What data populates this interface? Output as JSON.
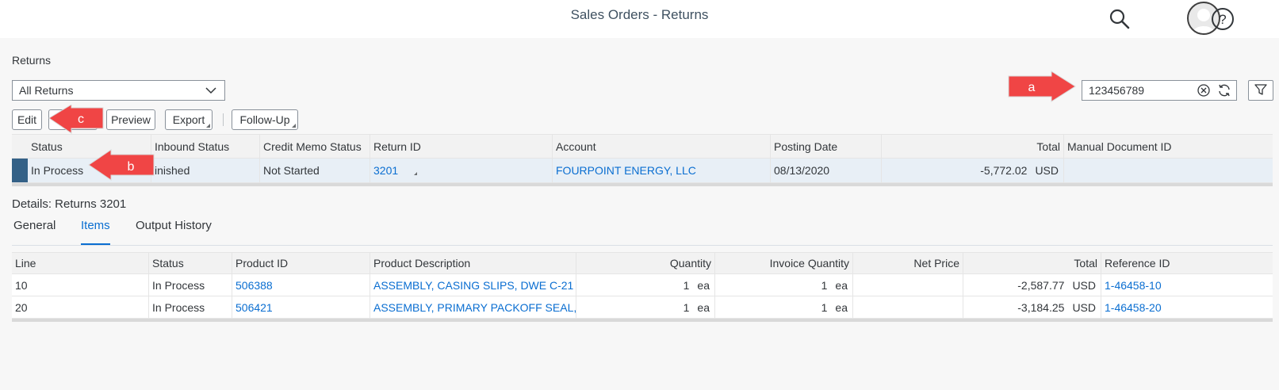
{
  "shell": {
    "title": "Sales Orders - Returns",
    "icons": [
      "search-icon",
      "user-avatar",
      "help-icon"
    ]
  },
  "returns": {
    "title": "Returns",
    "variant": "All Returns",
    "search_value": "123456789",
    "toolbar": {
      "edit": "Edit",
      "preview": "Preview",
      "export": "Export",
      "follow_up": "Follow-Up"
    },
    "columns": [
      "Status",
      "Inbound Status",
      "Credit Memo Status",
      "Return ID",
      "Account",
      "Posting Date",
      "Total",
      "Manual Document ID"
    ],
    "rows": [
      {
        "status": "In Process",
        "inbound_status": "inished",
        "credit_memo_status": "Not Started",
        "return_id": "3201",
        "account": "FOURPOINT ENERGY, LLC",
        "posting_date": "08/13/2020",
        "total": "-5,772.02",
        "currency": "USD",
        "manual_document_id": ""
      }
    ]
  },
  "details": {
    "title": "Details: Returns 3201",
    "tabs": [
      "General",
      "Items",
      "Output History"
    ],
    "active_tab": "Items",
    "columns": [
      "Line",
      "Status",
      "Product ID",
      "Product Description",
      "Quantity",
      "Invoice Quantity",
      "Net Price",
      "Total",
      "Reference ID"
    ],
    "rows": [
      {
        "line": "10",
        "status": "In Process",
        "product_id": "506388",
        "description": "ASSEMBLY, CASING SLIPS, DWE C-21",
        "quantity": "1",
        "quantity_unit": "ea",
        "invoice_quantity": "1",
        "invoice_unit": "ea",
        "net_price": "",
        "total": "-2,587.77",
        "currency": "USD",
        "reference_id": "1-46458-10"
      },
      {
        "line": "20",
        "status": "In Process",
        "product_id": "506421",
        "description": "ASSEMBLY, PRIMARY PACKOFF SEAL,",
        "quantity": "1",
        "quantity_unit": "ea",
        "invoice_quantity": "1",
        "invoice_unit": "ea",
        "net_price": "",
        "total": "-3,184.25",
        "currency": "USD",
        "reference_id": "1-46458-20"
      }
    ]
  },
  "annotations": {
    "a": "a",
    "b": "b",
    "c": "c"
  },
  "colors": {
    "accent": "#0a6ed1",
    "title": "#3f5161",
    "selection": "#346187",
    "arrow": "#f04545"
  }
}
